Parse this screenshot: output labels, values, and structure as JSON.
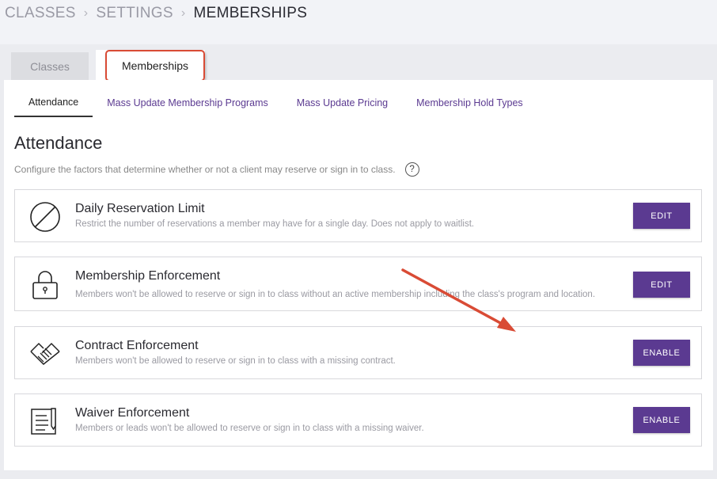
{
  "breadcrumb": {
    "items": [
      "CLASSES",
      "SETTINGS",
      "MEMBERSHIPS"
    ]
  },
  "tabs": {
    "classes": "Classes",
    "memberships": "Memberships"
  },
  "subtabs": [
    "Attendance",
    "Mass Update Membership Programs",
    "Mass Update Pricing",
    "Membership Hold Types"
  ],
  "section": {
    "title": "Attendance",
    "description": "Configure the factors that determine whether or not a client may reserve or sign in to class.",
    "help": "?"
  },
  "cards": [
    {
      "title": "Daily Reservation Limit",
      "description": "Restrict the number of reservations a member may have for a single day. Does not apply to waitlist.",
      "button": "EDIT",
      "icon": "prohibited-icon"
    },
    {
      "title": "Membership Enforcement",
      "description": "Members won't be allowed to reserve or sign in to class without an active membership including the class's program and location.",
      "button": "EDIT",
      "icon": "lock-icon"
    },
    {
      "title": "Contract Enforcement",
      "description": "Members won't be allowed to reserve or sign in to class with a missing contract.",
      "button": "ENABLE",
      "icon": "handshake-icon"
    },
    {
      "title": "Waiver Enforcement",
      "description": "Members or leads won't be allowed to reserve or sign in to class with a missing waiver.",
      "button": "ENABLE",
      "icon": "document-pen-icon"
    }
  ],
  "colors": {
    "accent": "#5b3a91",
    "highlight": "#d94b35"
  }
}
